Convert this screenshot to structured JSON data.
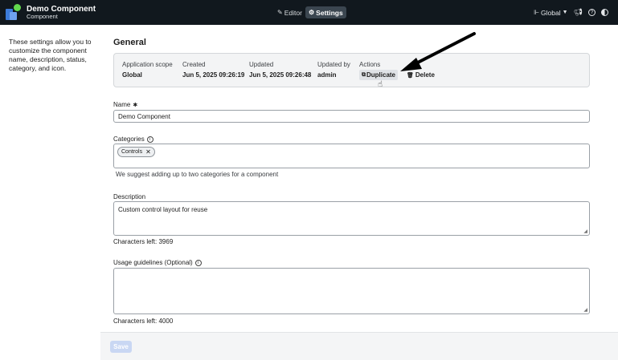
{
  "app": {
    "title": "Demo Component",
    "subtitle": "Component"
  },
  "nav": {
    "editor_label": "Editor",
    "settings_label": "Settings",
    "scope_label": "Global"
  },
  "help_text": "These settings allow you to customize the component name, description, status, category, and icon.",
  "section": {
    "title": "General"
  },
  "info": {
    "scope_label": "Application scope",
    "scope_value": "Global",
    "created_label": "Created",
    "created_value": "Jun 5, 2025 09:26:19",
    "updated_label": "Updated",
    "updated_value": "Jun 5, 2025 09:26:48",
    "updated_by_label": "Updated by",
    "updated_by_value": "admin",
    "actions_label": "Actions",
    "duplicate_label": "Duplicate",
    "delete_label": "Delete"
  },
  "name": {
    "label": "Name",
    "required_mark": "✱",
    "value": "Demo Component"
  },
  "categories": {
    "label": "Categories",
    "chips": [
      "Controls"
    ],
    "hint": "We suggest adding up to two categories for a component"
  },
  "description": {
    "label": "Description",
    "value": "Custom control layout for reuse",
    "chars_left": "Characters left: 3969"
  },
  "usage": {
    "label": "Usage guidelines (Optional)",
    "value": "",
    "chars_left": "Characters left: 4000"
  },
  "footer": {
    "save_label": "Save"
  },
  "colors": {
    "topbar": "#11181e",
    "accent": "#3c7bd9",
    "save_disabled": "#c9d7f3"
  },
  "icons": [
    "pencil-icon",
    "gear-icon",
    "hierarchy-icon",
    "chevron-down-icon",
    "megaphone-icon",
    "help-icon",
    "contrast-icon",
    "copy-icon",
    "trash-icon",
    "info-icon",
    "close-icon"
  ]
}
